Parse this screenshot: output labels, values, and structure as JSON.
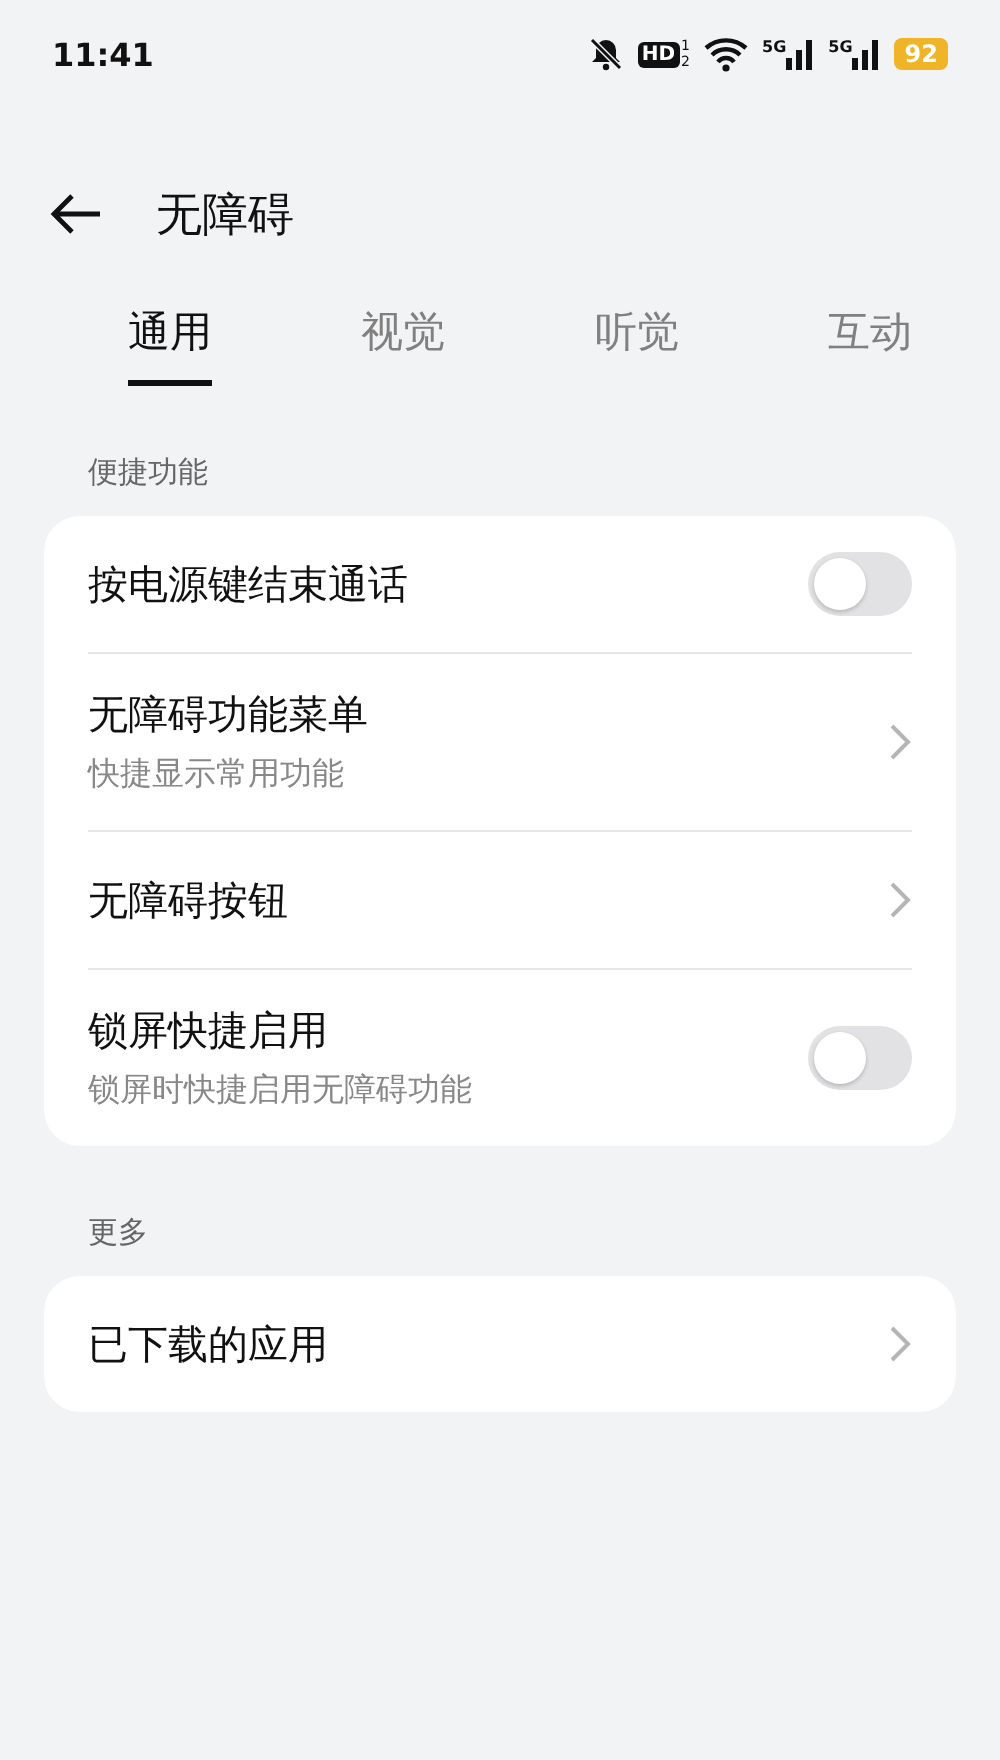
{
  "status_bar": {
    "time": "11:41",
    "hd": "HD",
    "hd_slots": [
      "1",
      "2"
    ],
    "networks": [
      "5G",
      "5G"
    ],
    "battery": "92"
  },
  "header": {
    "title": "无障碍"
  },
  "tabs": [
    {
      "label": "通用",
      "selected": true
    },
    {
      "label": "视觉",
      "selected": false
    },
    {
      "label": "听觉",
      "selected": false
    },
    {
      "label": "互动",
      "selected": false
    }
  ],
  "sections": [
    {
      "title": "便捷功能",
      "items": [
        {
          "kind": "toggle",
          "label": "按电源键结束通话",
          "on": false
        },
        {
          "kind": "link",
          "label": "无障碍功能菜单",
          "subtitle": "快捷显示常用功能"
        },
        {
          "kind": "link",
          "label": "无障碍按钮"
        },
        {
          "kind": "toggle",
          "label": "锁屏快捷启用",
          "subtitle": "锁屏时快捷启用无障碍功能",
          "on": false
        }
      ]
    },
    {
      "title": "更多",
      "items": [
        {
          "kind": "link",
          "label": "已下载的应用"
        }
      ]
    }
  ]
}
